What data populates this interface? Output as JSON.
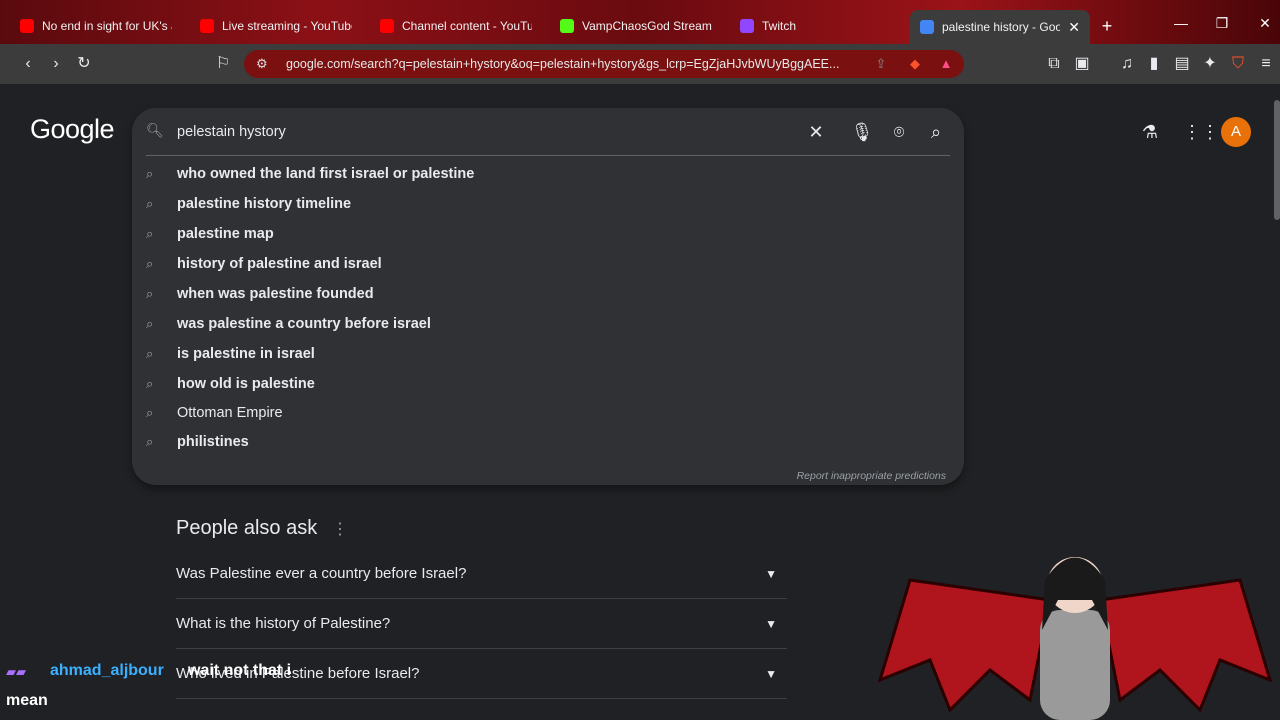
{
  "tabs": [
    {
      "title": "No end in sight for UK's as",
      "icon": "youtube-icon",
      "color": "#ff0000"
    },
    {
      "title": "Live streaming - YouTube S",
      "icon": "youtube-icon",
      "color": "#ff0000"
    },
    {
      "title": "Channel content - YouTube",
      "icon": "youtube-icon",
      "color": "#ff0000"
    },
    {
      "title": "VampChaosGod Stream - K",
      "icon": "kick-icon",
      "color": "#53fc18"
    },
    {
      "title": "Twitch",
      "icon": "twitch-icon",
      "color": "#9146ff"
    },
    {
      "title": "palestine history - Goo",
      "icon": "google-icon",
      "color": "#4285f4"
    }
  ],
  "address_bar": {
    "url": "google.com/search?q=pelestain+hystory&oq=pelestain+hystory&gs_lcrp=EgZjaHJvbWUyBggAEE..."
  },
  "google": {
    "logo_text": "Google",
    "avatar_letter": "A",
    "accent": "#e8710a"
  },
  "search": {
    "query": "pelestain hystory",
    "suggestions": [
      {
        "text": "who owned the land first israel or palestine",
        "bold": true
      },
      {
        "text": "palestine history timeline",
        "bold": true
      },
      {
        "text": "palestine map",
        "bold": true
      },
      {
        "text": "history of palestine and israel",
        "bold": true
      },
      {
        "text": "when was palestine founded",
        "bold": true
      },
      {
        "text": "was palestine a country before israel",
        "bold": true
      },
      {
        "text": "is palestine in israel",
        "bold": true
      },
      {
        "text": "how old is palestine",
        "bold": true
      },
      {
        "text": "Ottoman Empire",
        "bold": false
      },
      {
        "text": "philistines",
        "bold": true
      }
    ],
    "report_link": "Report inappropriate predictions"
  },
  "people_also_ask": {
    "title": "People also ask",
    "questions": [
      "Was Palestine ever a country before Israel?",
      "What is the history of Palestine?",
      "Who lived in Palestine before Israel?"
    ]
  },
  "chat": {
    "username": "ahmad_aljbour",
    "message": "wait not that i",
    "message_line2": "mean"
  }
}
